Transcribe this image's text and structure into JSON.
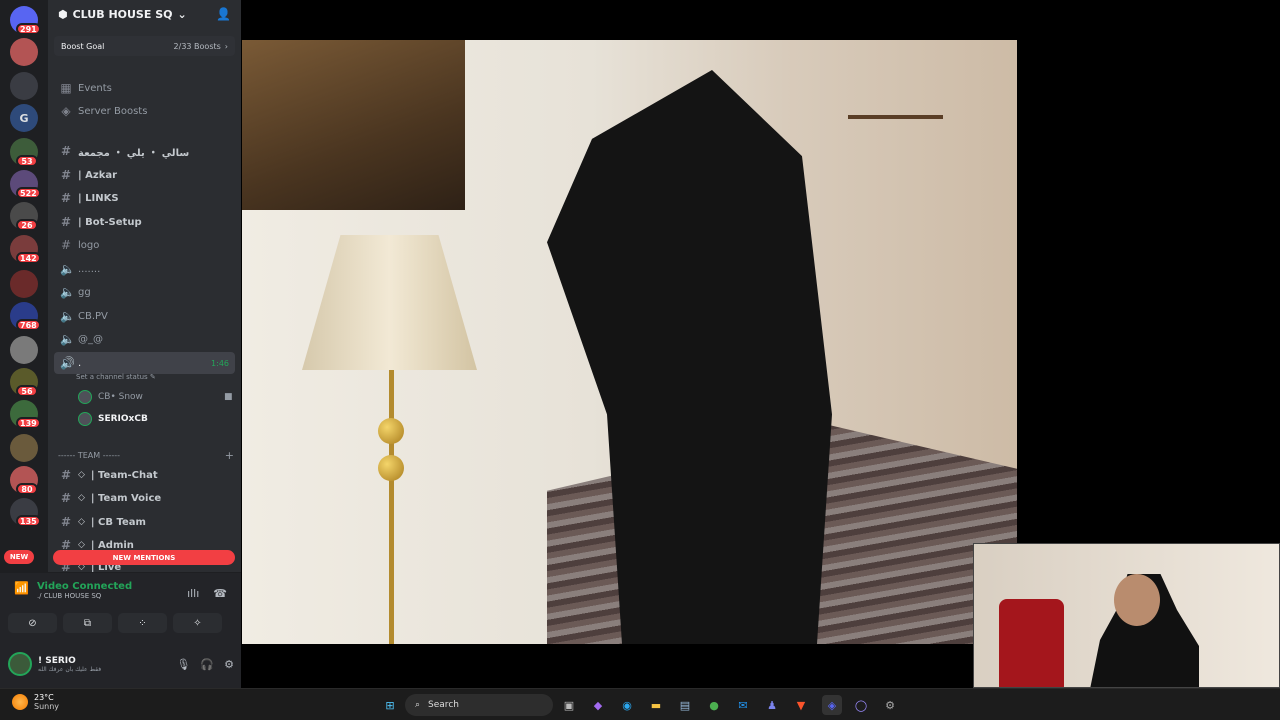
{
  "rail": {
    "items": [
      {
        "icon": "discord-home-icon",
        "badge": "291"
      },
      {
        "icon": "server-avatar",
        "badge": ""
      },
      {
        "icon": "server-avatar",
        "badge": ""
      },
      {
        "icon": "server-letter",
        "label": "G",
        "badge": ""
      },
      {
        "icon": "server-avatar",
        "badge": "53"
      },
      {
        "icon": "server-avatar",
        "badge": "522"
      },
      {
        "icon": "server-avatar",
        "badge": "26"
      },
      {
        "icon": "server-avatar",
        "badge": "142"
      },
      {
        "icon": "server-avatar",
        "badge": ""
      },
      {
        "icon": "server-avatar",
        "badge": "768"
      },
      {
        "icon": "server-avatar",
        "badge": ""
      },
      {
        "icon": "server-avatar",
        "badge": "56"
      },
      {
        "icon": "server-avatar",
        "badge": "139"
      },
      {
        "icon": "server-avatar",
        "badge": ""
      },
      {
        "icon": "server-avatar",
        "badge": "80"
      },
      {
        "icon": "server-avatar",
        "badge": "135"
      }
    ],
    "new_label": "NEW"
  },
  "server": {
    "name": "CLUB HOUSE SQ",
    "boost_label": "Boost Goal",
    "boost_count": "2/33 Boosts",
    "events": "Events",
    "server_boosts": "Server Boosts"
  },
  "channels": [
    {
      "type": "text",
      "name": "سالي ・ يلي ・ مجمعة"
    },
    {
      "type": "text",
      "name": "| Azkar"
    },
    {
      "type": "text",
      "name": "| LINKS"
    },
    {
      "type": "text",
      "name": "| Bot-Setup"
    },
    {
      "type": "text",
      "name": "logo"
    },
    {
      "type": "voice",
      "name": "......."
    },
    {
      "type": "voice",
      "name": "gg"
    },
    {
      "type": "voice",
      "name": "CB.PV"
    },
    {
      "type": "voice",
      "name": "@_@"
    }
  ],
  "active_channel": {
    "name": ".",
    "time": "1:46",
    "status": "Set a channel status"
  },
  "voice_users": [
    {
      "name": "CB• Snow",
      "video": true
    },
    {
      "name": "SERIOxCB",
      "video": false
    }
  ],
  "category": "------ TEAM ------",
  "team_channels": [
    {
      "name": "| Team-Chat"
    },
    {
      "name": "| Team Voice"
    },
    {
      "name": "| CB Team"
    },
    {
      "name": "| Admin"
    },
    {
      "name": "| Live"
    }
  ],
  "mentions_label": "NEW MENTIONS",
  "voice_panel": {
    "status": "Video Connected",
    "location": "./ CLUB HOUSE SQ"
  },
  "user": {
    "name": "! SERIO",
    "custom_status": "فقط عليك بان عرفك الله"
  },
  "taskbar": {
    "temp": "23°C",
    "condition": "Sunny",
    "search": "Search"
  }
}
